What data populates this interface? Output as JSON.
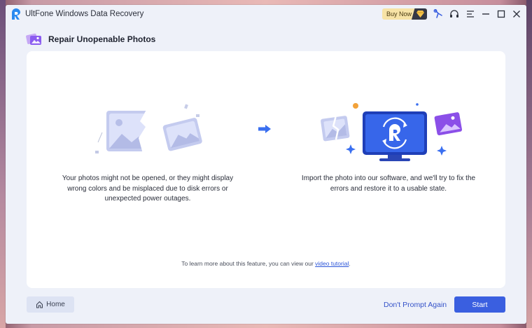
{
  "app": {
    "title": "UltFone Windows Data Recovery",
    "buy_now": "Buy Now"
  },
  "header": {
    "title": "Repair Unopenable Photos"
  },
  "steps": [
    {
      "description": "Your photos might not be opened, or they might display wrong colors and be misplaced due to disk errors or unexpected power outages."
    },
    {
      "description": "Import the photo into our software, and we'll try to fix the errors and restore it to a usable state."
    }
  ],
  "learn_more": {
    "prefix": "To learn more about this feature, you can view our ",
    "link": "video tutorial",
    "suffix": "."
  },
  "footer": {
    "home": "Home",
    "dont_prompt": "Don't Prompt Again",
    "start": "Start"
  },
  "colors": {
    "accent": "#3a5fe0",
    "link": "#2b55d9",
    "buy_bg": "#f7e3a6",
    "window_bg": "#eef1f9"
  },
  "icons": [
    "app-logo",
    "diamond-icon",
    "pin-icon",
    "headset-icon",
    "menu-icon",
    "minimize-icon",
    "maximize-icon",
    "close-icon",
    "photo-repair-icon",
    "home-icon"
  ]
}
